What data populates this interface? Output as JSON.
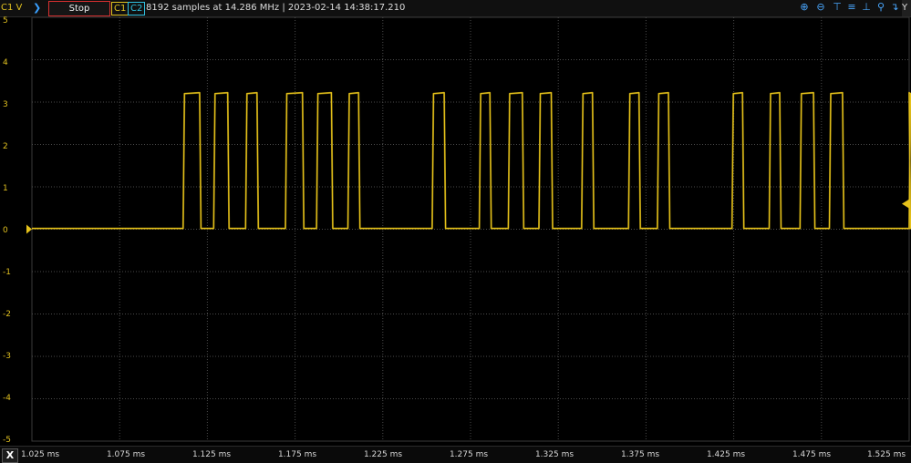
{
  "toolbar": {
    "channel_label": "C1 V",
    "stop_label": "Stop",
    "c1_label": "C1",
    "c2_label": "C2",
    "info": "8192 samples at 14.286 MHz | 2023-02-14 14:38:17.210",
    "y_label": "Y",
    "icons": [
      "zoom-in-icon",
      "zoom-out-icon",
      "align-top-icon",
      "align-middle-icon",
      "align-bottom-icon",
      "zoom-fit-icon",
      "magnify-icon",
      "cursor-icon"
    ]
  },
  "colors": {
    "trace": "#e6c21a",
    "grid": "#4a4a4a",
    "c2": "#2fc0e0",
    "stop_border": "#d83030"
  },
  "y_ticks": [
    "5",
    "4",
    "3",
    "2",
    "1",
    "0",
    "-1",
    "-2",
    "-3",
    "-4",
    "-5"
  ],
  "x_ticks": [
    "1.025 ms",
    "1.075 ms",
    "1.125 ms",
    "1.175 ms",
    "1.225 ms",
    "1.275 ms",
    "1.325 ms",
    "1.375 ms",
    "1.425 ms",
    "1.475 ms",
    "1.525 ms"
  ],
  "x_button": "X",
  "chart_data": {
    "type": "line",
    "x_unit": "ms",
    "y_unit": "V",
    "xlim": [
      1.025,
      1.525
    ],
    "ylim": [
      -5,
      5
    ],
    "grid": true,
    "low_level": 0.02,
    "high_level": 3.2,
    "pulses": [
      [
        1.1112,
        1.1206
      ],
      [
        1.1286,
        1.1366
      ],
      [
        1.1468,
        1.1533
      ],
      [
        1.1695,
        1.1792
      ],
      [
        1.1872,
        1.1957
      ],
      [
        1.2051,
        1.2112
      ],
      [
        1.2531,
        1.26
      ],
      [
        1.28,
        1.286
      ],
      [
        1.2965,
        1.3045
      ],
      [
        1.314,
        1.321
      ],
      [
        1.3383,
        1.3445
      ],
      [
        1.365,
        1.371
      ],
      [
        1.3815,
        1.3878
      ],
      [
        1.424,
        1.43
      ],
      [
        1.4452,
        1.4512
      ],
      [
        1.4628,
        1.4705
      ],
      [
        1.4795,
        1.487
      ],
      [
        1.526,
        1.53
      ]
    ]
  }
}
